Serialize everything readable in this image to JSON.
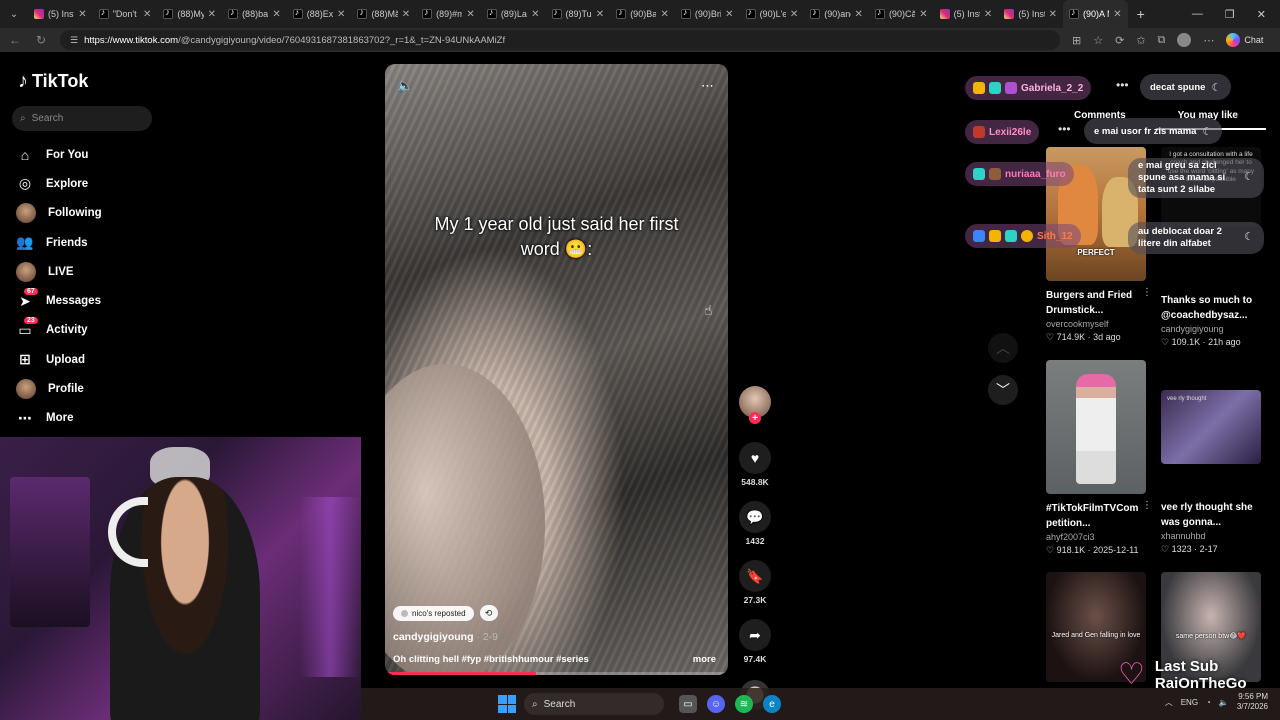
{
  "browser": {
    "tabs": [
      {
        "title": "(5) Insta",
        "icon": "instagram-icon",
        "active": false
      },
      {
        "title": "\"Don't w",
        "icon": "tiktok-icon",
        "active": false
      },
      {
        "title": "(88)My",
        "icon": "tiktok-icon",
        "active": false
      },
      {
        "title": "(88)bac",
        "icon": "tiktok-icon",
        "active": false
      },
      {
        "title": "(88)Exp",
        "icon": "tiktok-icon",
        "active": false
      },
      {
        "title": "(88)Măi",
        "icon": "tiktok-icon",
        "active": false
      },
      {
        "title": "(89)#m",
        "icon": "tiktok-icon",
        "active": false
      },
      {
        "title": "(89)La f",
        "icon": "tiktok-icon",
        "active": false
      },
      {
        "title": "(89)Tu c",
        "icon": "tiktok-icon",
        "active": false
      },
      {
        "title": "(90)Bat",
        "icon": "tiktok-icon",
        "active": false
      },
      {
        "title": "(90)Brit",
        "icon": "tiktok-icon",
        "active": false
      },
      {
        "title": "(90)L'ef",
        "icon": "tiktok-icon",
        "active": false
      },
      {
        "title": "(90)and",
        "icon": "tiktok-icon",
        "active": false
      },
      {
        "title": "(90)Căc",
        "icon": "tiktok-icon",
        "active": false
      },
      {
        "title": "(5) Insta",
        "icon": "instagram-icon",
        "active": false
      },
      {
        "title": "(5) Inst",
        "icon": "instagram-icon",
        "active": false
      },
      {
        "title": "(90)A M",
        "icon": "tiktok-icon",
        "active": true
      }
    ],
    "url_host": "https://www.tiktok.com",
    "url_path": "/@candygigiyoung/video/7604931687381863702?_r=1&_t=ZN-94UNkAAMiZf",
    "chat_label": "Chat"
  },
  "sidebar": {
    "logo": "TikTok",
    "search_placeholder": "Search",
    "items": [
      {
        "label": "For You",
        "icon": "home-icon"
      },
      {
        "label": "Explore",
        "icon": "compass-icon"
      },
      {
        "label": "Following",
        "icon": "avatar-icon"
      },
      {
        "label": "Friends",
        "icon": "friends-icon"
      },
      {
        "label": "LIVE",
        "icon": "live-avatar-icon"
      },
      {
        "label": "Messages",
        "icon": "send-icon",
        "badge": "67"
      },
      {
        "label": "Activity",
        "icon": "inbox-icon",
        "badge": "23"
      },
      {
        "label": "Upload",
        "icon": "plus-square-icon"
      },
      {
        "label": "Profile",
        "icon": "avatar-icon"
      },
      {
        "label": "More",
        "icon": "more-icon"
      }
    ]
  },
  "video": {
    "caption_overlay": "My 1 year old just said her first word 😬:",
    "repost_label": "nico's reposted",
    "author": "candygigiyoung",
    "date": " · 2-9",
    "description": "Oh clitting hell #fyp #britishhumour #series",
    "more_label": "more",
    "progress": 0.44
  },
  "actions": {
    "likes": "548.8K",
    "comments": "1432",
    "saves": "27.3K",
    "shares": "97.4K"
  },
  "stream_chat": {
    "users": [
      {
        "name": "Gabriela_2_2",
        "message": "decat spune"
      },
      {
        "name": "Lexii26le",
        "message": "e mai usor fr zis mama"
      },
      {
        "name": "nuriaaa_furo",
        "message": "e mai greu sa zici spune asa mama si tata sunt 2 silabe"
      },
      {
        "name": "Sith_12",
        "message": "au deblocat doar 2 litere din alfabet"
      }
    ]
  },
  "panel": {
    "tabs": [
      "Comments",
      "You may like"
    ],
    "cards": [
      {
        "title": "Burgers and Fried Drumstick...",
        "author": "overcookmyself",
        "likes": "714.9K",
        "date": "3d ago",
        "thumb_label": "PERFECT"
      },
      {
        "title": "Thanks so much to @coachedbysaz...",
        "author": "candygigiyoung",
        "likes": "109.1K",
        "date": "21h ago",
        "thumb_label": "I got a consultation with a life coach and challenged her to use the word 'clitting' as many times as possible"
      },
      {
        "title": "#TikTokFilmTVCom petition...",
        "author": "ahyf2007ci3",
        "likes": "918.1K",
        "date": "2025-12-11",
        "thumb_label": ""
      },
      {
        "title": "vee rly thought she was gonna...",
        "author": "xhannuhbd",
        "likes": "1323",
        "date": "2-17",
        "thumb_label": "vee rly thought"
      },
      {
        "title": "",
        "author": "",
        "likes": "",
        "date": "",
        "thumb_label": "Jared and Gen falling in love"
      },
      {
        "title": "",
        "author": "",
        "likes": "",
        "date": "",
        "thumb_label": "same person btw😂❤️"
      }
    ]
  },
  "overlay": {
    "last_sub_label": "Last Sub",
    "last_sub_name": "RaiOnTheGo"
  },
  "taskbar": {
    "search_label": "Search",
    "lang": "ENG",
    "time": "9:56 PM",
    "date": "3/7/2026"
  }
}
